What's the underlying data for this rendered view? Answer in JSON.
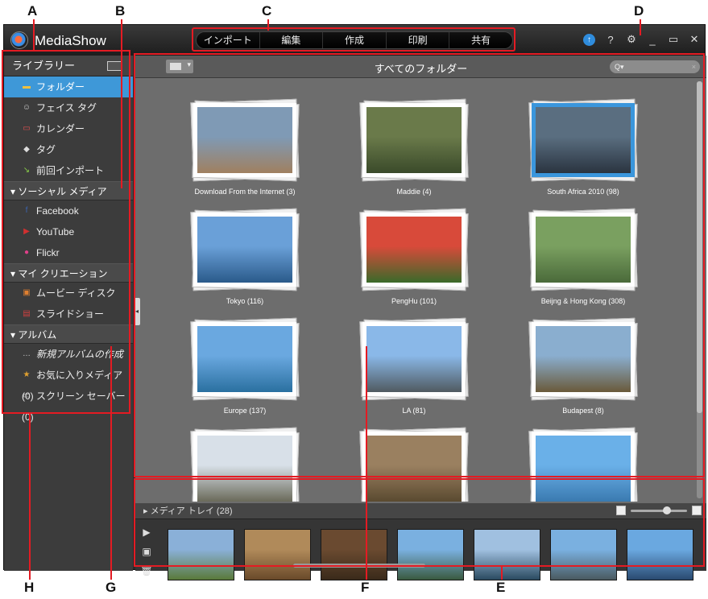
{
  "callouts": {
    "a": "A",
    "b": "B",
    "c": "C",
    "d": "D",
    "e": "E",
    "f": "F",
    "g": "G",
    "h": "H"
  },
  "app": {
    "name": "MediaShow"
  },
  "menu": [
    "インポート",
    "編集",
    "作成",
    "印刷",
    "共有"
  ],
  "window_controls": {
    "upgrade": "↑",
    "help": "?",
    "settings": "⚙",
    "minimize": "_",
    "restore": "▭",
    "close": "✕"
  },
  "sidebar": {
    "library_header": "ライブラリー",
    "library_items": [
      {
        "label": "フォルダー",
        "icon": "folder-icon",
        "active": true
      },
      {
        "label": "フェイス タグ",
        "icon": "face-tag-icon"
      },
      {
        "label": "カレンダー",
        "icon": "calendar-icon"
      },
      {
        "label": "タグ",
        "icon": "tag-icon"
      },
      {
        "label": "前回インポート",
        "icon": "last-import-icon"
      }
    ],
    "social_header": "▾ ソーシャル メディア",
    "social_items": [
      {
        "label": "Facebook",
        "icon": "facebook-icon"
      },
      {
        "label": "YouTube",
        "icon": "youtube-icon"
      },
      {
        "label": "Flickr",
        "icon": "flickr-icon"
      }
    ],
    "creation_header": "▾ マイ クリエーション",
    "creation_items": [
      {
        "label": "ムービー ディスク",
        "icon": "movie-disc-icon"
      },
      {
        "label": "スライドショー",
        "icon": "slideshow-icon"
      }
    ],
    "album_header": "▾ アルバム",
    "album_items": [
      {
        "label": "新規アルバムの作成",
        "icon": "new-album-icon"
      },
      {
        "label": "お気に入りメディア (0)",
        "icon": "favorite-icon"
      },
      {
        "label": "スクリーン セーバー (0)",
        "icon": "screensaver-icon"
      }
    ]
  },
  "main": {
    "title": "すべてのフォルダー",
    "search_placeholder": "Q▾",
    "albums": [
      {
        "label": "Download From the Internet (3)",
        "c1": "#7f9ab5",
        "c2": "#a08060",
        "selected": false
      },
      {
        "label": "Maddie (4)",
        "c1": "#6a7a4a",
        "c2": "#3a4a2a",
        "selected": false
      },
      {
        "label": "South Africa 2010 (98)",
        "c1": "#5a6e80",
        "c2": "#2a3440",
        "selected": true
      },
      {
        "label": "Tokyo (116)",
        "c1": "#6aa0d8",
        "c2": "#2a5a8a",
        "selected": false
      },
      {
        "label": "PengHu (101)",
        "c1": "#d84a3a",
        "c2": "#3a6a2a",
        "selected": false
      },
      {
        "label": "Beijng & Hong Kong (308)",
        "c1": "#7aa060",
        "c2": "#4a6a3a",
        "selected": false
      },
      {
        "label": "Europe (137)",
        "c1": "#6aa8e0",
        "c2": "#2a70a0",
        "selected": false
      },
      {
        "label": "LA (81)",
        "c1": "#8ab8e8",
        "c2": "#505a60",
        "selected": false
      },
      {
        "label": "Budapest (8)",
        "c1": "#8aaecf",
        "c2": "#6a5a3a",
        "selected": false
      },
      {
        "label": "",
        "c1": "#d8e0e8",
        "c2": "#6a6a5a",
        "selected": false
      },
      {
        "label": "",
        "c1": "#9a8060",
        "c2": "#5a4a30",
        "selected": false
      },
      {
        "label": "",
        "c1": "#6ab0e8",
        "c2": "#3a7ab0",
        "selected": false
      }
    ]
  },
  "tray": {
    "label": "▸ メディア トレイ (28)",
    "buttons": {
      "play": "▶",
      "save": "▣",
      "delete": "🗑"
    },
    "thumbs": [
      {
        "c1": "#8ab0d8",
        "c2": "#5a7a3a"
      },
      {
        "c1": "#b08a5a",
        "c2": "#6a4a2a"
      },
      {
        "c1": "#6a4a30",
        "c2": "#3a2a1a"
      },
      {
        "c1": "#7ab0e0",
        "c2": "#3a5a40"
      },
      {
        "c1": "#a0c0e0",
        "c2": "#2a4a60"
      },
      {
        "c1": "#7ab0e0",
        "c2": "#4a5a60"
      },
      {
        "c1": "#6aa8e0",
        "c2": "#2a4a70"
      }
    ]
  },
  "colors": {
    "accent": "#3e98d8",
    "callout_red": "#e41b23"
  }
}
